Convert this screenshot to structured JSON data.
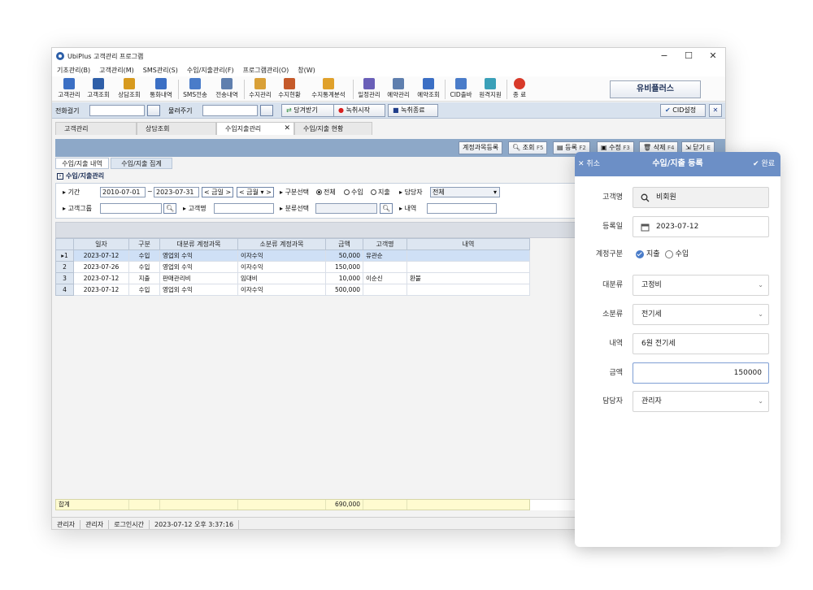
{
  "window": {
    "title": "UbiPlus 고객관리 프로그램",
    "controls": {
      "minimize": "−",
      "maximize": "☐",
      "close": "✕"
    }
  },
  "menu": [
    "기초관리(B)",
    "고객관리(M)",
    "SMS관리(S)",
    "수입/지출관리(F)",
    "프로그램관리(O)",
    "창(W)"
  ],
  "toolbar": {
    "items": [
      {
        "label": "고객관리",
        "icon": "customer-icon",
        "color": "#3b6fc4"
      },
      {
        "label": "고객조회",
        "icon": "search-customer-icon",
        "color": "#2f5fa8"
      },
      {
        "label": "상담조회",
        "icon": "consult-icon",
        "color": "#d79a1e"
      },
      {
        "label": "통화내역",
        "icon": "call-icon",
        "color": "#3b6fc4"
      },
      {
        "label": "SMS전송",
        "icon": "sms-icon",
        "color": "#4a7cc9"
      },
      {
        "label": "전송내역",
        "icon": "history-icon",
        "color": "#5f7fae"
      },
      {
        "label": "수지관리",
        "icon": "finance-icon",
        "color": "#d9a037"
      },
      {
        "label": "수지현황",
        "icon": "finance-status-icon",
        "color": "#c55a2a"
      },
      {
        "label": "수지통계분석",
        "icon": "stats-icon",
        "color": "#e0a12b"
      },
      {
        "label": "일정관리",
        "icon": "schedule-icon",
        "color": "#6a5fb8"
      },
      {
        "label": "예약관리",
        "icon": "reservation-icon",
        "color": "#5f7fae"
      },
      {
        "label": "예약조회",
        "icon": "reservation-search-icon",
        "color": "#3b6fc4"
      },
      {
        "label": "CID출바",
        "icon": "cid-icon",
        "color": "#4a7cc9"
      },
      {
        "label": "원격지원",
        "icon": "remote-icon",
        "color": "#3aa0b8"
      },
      {
        "label": "종 료",
        "icon": "exit-icon",
        "color": "#d83a2a"
      }
    ],
    "brand": "유비플러스"
  },
  "phonebar": {
    "call_label": "전화걸기",
    "hangup_label": "물려주기",
    "receive_btn": "당겨받기",
    "rec_start_btn": "녹취시작",
    "rec_stop_btn": "녹취종료",
    "cid_btn": "CID설정"
  },
  "doc_tabs": [
    {
      "label": "고객관리"
    },
    {
      "label": "상담조회"
    },
    {
      "label": "수입지출관리",
      "active": true
    },
    {
      "label": "수입/지출 현황"
    }
  ],
  "actions": {
    "account_reg": "계정과목등록",
    "query": "조회",
    "query_key": "F5",
    "register": "등록",
    "register_key": "F2",
    "edit": "수정",
    "edit_key": "F3",
    "delete": "삭제",
    "delete_key": "F4",
    "close": "닫기",
    "close_key": "E"
  },
  "sub_tabs": [
    "수입/지출 내역",
    "수입/지출 집계"
  ],
  "section_title": "수입/지출관리",
  "filter": {
    "period_label": "기간",
    "date_from": "2010-07-01",
    "tilde": "~",
    "date_to": "2023-07-31",
    "today_btn": "금일",
    "month_btn": "금월",
    "type_label": "구분선택",
    "type_options": [
      "전체",
      "수입",
      "지출"
    ],
    "type_selected": "전체",
    "manager_label": "담당자",
    "manager_value": "전체",
    "group_label": "고객그룹",
    "name_label": "고객명",
    "category_label": "분류선택",
    "detail_label": "내역"
  },
  "grid": {
    "columns": [
      "일자",
      "구분",
      "대분류 계정과목",
      "소분류 계정과목",
      "금액",
      "고객명",
      "내역"
    ],
    "rows": [
      {
        "no": "1",
        "date": "2023-07-12",
        "type": "수입",
        "major": "영업외 수익",
        "minor": "이자수익",
        "amount": "50,000",
        "customer": "유관순",
        "detail": ""
      },
      {
        "no": "2",
        "date": "2023-07-26",
        "type": "수입",
        "major": "영업외 수익",
        "minor": "이자수익",
        "amount": "150,000",
        "customer": "",
        "detail": ""
      },
      {
        "no": "3",
        "date": "2023-07-12",
        "type": "지출",
        "major": "판매관리비",
        "minor": "임대비",
        "amount": "10,000",
        "customer": "이순신",
        "detail": "환불"
      },
      {
        "no": "4",
        "date": "2023-07-12",
        "type": "수입",
        "major": "영업외 수익",
        "minor": "이자수익",
        "amount": "500,000",
        "customer": "",
        "detail": ""
      }
    ],
    "total_label": "합계",
    "total_amount": "690,000"
  },
  "status": {
    "user1": "관리자",
    "user2": "관리자",
    "login_label": "로그인시간",
    "login_time": "2023-07-12 오후 3:37:16"
  },
  "panel": {
    "cancel": "취소",
    "title": "수입/지출 등록",
    "done": "완료",
    "customer_label": "고객명",
    "customer_value": "비회원",
    "date_label": "등록일",
    "date_value": "2023-07-12",
    "account_type_label": "계정구분",
    "account_type_options": [
      "지출",
      "수입"
    ],
    "account_type_selected": "지출",
    "major_label": "대분류",
    "major_value": "고정비",
    "minor_label": "소분류",
    "minor_value": "전기세",
    "detail_label": "내역",
    "detail_value": "6원 전기세",
    "amount_label": "금액",
    "amount_value": "150000",
    "manager_label": "담당자",
    "manager_value": "관리자"
  },
  "colors": {
    "accent": "#6c8fc6",
    "toolbar_blue": "#8da8c8",
    "grid_header": "#dde6f1",
    "selected_row": "#cfe0f6",
    "total_row": "#fffbd0",
    "rec_red": "#d81e1e"
  }
}
